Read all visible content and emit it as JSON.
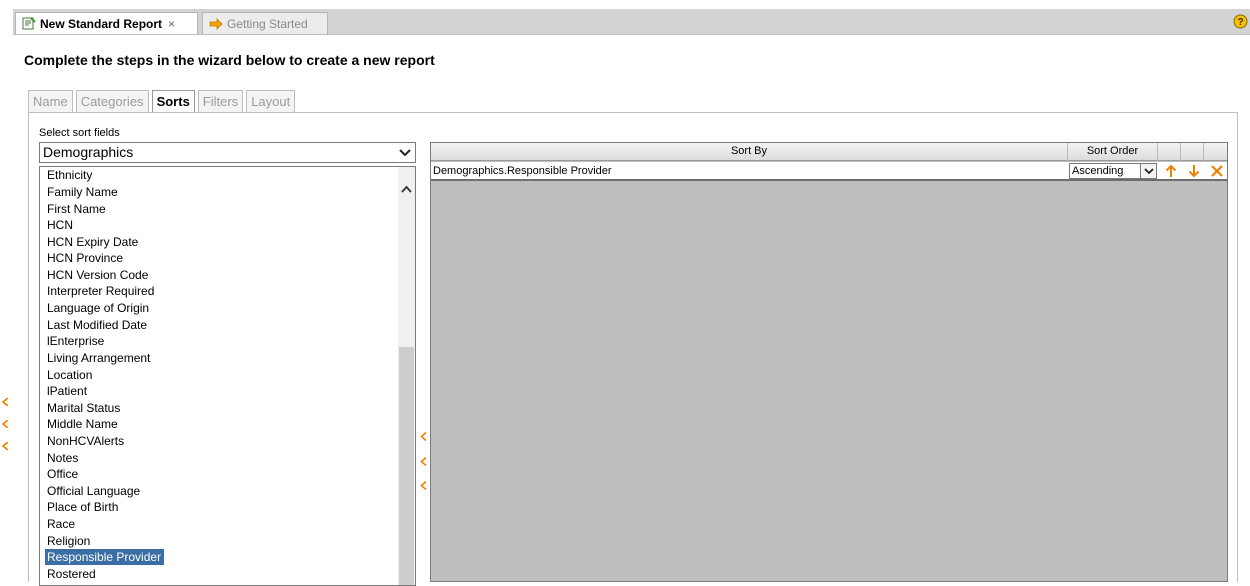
{
  "tabs": [
    {
      "label": "New Standard Report",
      "close": "×"
    },
    {
      "label": "Getting Started"
    }
  ],
  "wizard": {
    "title": "Complete the steps in the wizard below to create a new report",
    "steps": [
      "Name",
      "Categories",
      "Sorts",
      "Filters",
      "Layout"
    ],
    "active_step": "Sorts"
  },
  "sort_fields": {
    "label": "Select sort fields",
    "category": "Demographics",
    "items": [
      "Ethnicity",
      "Family Name",
      "First Name",
      "HCN",
      "HCN Expiry Date",
      "HCN Province",
      "HCN Version Code",
      "Interpreter Required",
      "Language of Origin",
      "Last Modified Date",
      "lEnterprise",
      "Living Arrangement",
      "Location",
      "lPatient",
      "Marital Status",
      "Middle Name",
      "NonHCVAlerts",
      "Notes",
      "Office",
      "Official Language",
      "Place of Birth",
      "Race",
      "Religion",
      "Responsible Provider",
      "Rostered"
    ],
    "selected": "Responsible Provider"
  },
  "sort_grid": {
    "col_sort_by": "Sort By",
    "col_sort_order": "Sort Order",
    "rows": [
      {
        "sort_by": "Demographics.Responsible Provider",
        "order": "Ascending"
      }
    ]
  },
  "colors": {
    "accent_orange": "#f08000",
    "selection_blue": "#3a6ea5",
    "grid_background": "#bebebe"
  },
  "icons": [
    "report-icon",
    "arrow-right-icon",
    "help-icon",
    "chevron-down-icon",
    "scroll-up-icon",
    "collapse-left-icon",
    "move-up-icon",
    "move-down-icon",
    "delete-icon"
  ]
}
